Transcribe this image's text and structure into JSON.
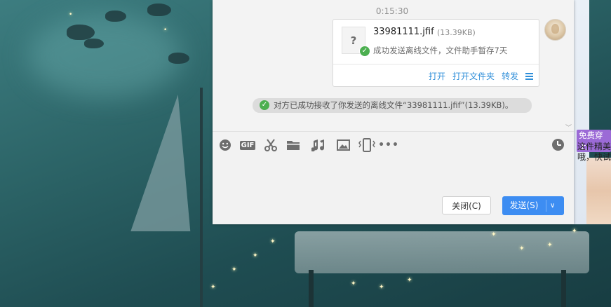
{
  "chat": {
    "timestamp": "0:15:30",
    "file_card": {
      "file_icon_glyph": "?",
      "file_name": "33981111.jfif",
      "file_size": "(13.39KB)",
      "status": "成功发送离线文件，文件助手暂存7天",
      "actions": [
        "打开",
        "打开文件夹",
        "转发"
      ]
    },
    "notice": "对方已成功接收了你发送的离线文件“33981111.jfif”(13.39KB)。",
    "toolbar": [
      "emoji-icon",
      "gif-icon",
      "screenshot-scissors-icon",
      "folder-icon",
      "music-icon",
      "image-icon",
      "shake-window-icon",
      "more-icon",
      "history-clock-icon"
    ],
    "toolbar_gif_label": "GIF",
    "input": {
      "value": "",
      "placeholder": ""
    },
    "close_label": "关闭(C)",
    "send_label": "发送(S)"
  },
  "ad": {
    "tag": "免费穿上",
    "text": "这件精美\n哦，快试"
  },
  "colors": {
    "accent": "#3d8df2",
    "link": "#2e8ed9",
    "success": "#4caf50",
    "ad_tag": "#9b6ad6"
  }
}
